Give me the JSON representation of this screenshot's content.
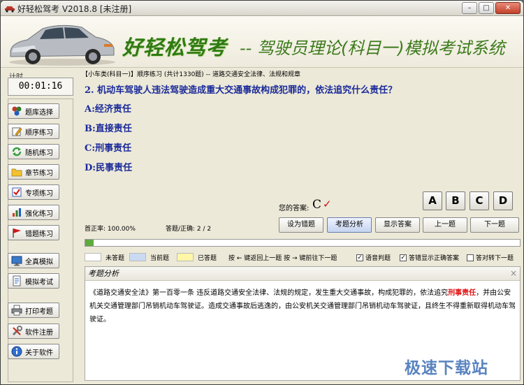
{
  "window": {
    "title": "好轻松驾考 V2018.8 [未注册]",
    "minimize": "–",
    "maximize": "□",
    "close": "✕"
  },
  "banner": {
    "title": "好轻松驾考",
    "subtitle": "-- 驾驶员理论(科目一)模拟考试系统"
  },
  "timer": {
    "label": "计时",
    "value": "00:01:16"
  },
  "sidebar": {
    "items": [
      {
        "label": "题库选择",
        "icon": "database-icon"
      },
      {
        "label": "顺序练习",
        "icon": "pencil-icon"
      },
      {
        "label": "随机练习",
        "icon": "shuffle-icon"
      },
      {
        "label": "章节练习",
        "icon": "folder-icon"
      },
      {
        "label": "专项练习",
        "icon": "checklist-icon"
      },
      {
        "label": "强化练习",
        "icon": "chart-icon"
      },
      {
        "label": "错题练习",
        "icon": "flag-icon"
      },
      {
        "label": "全真模拟",
        "icon": "monitor-icon"
      },
      {
        "label": "模拟考试",
        "icon": "document-icon"
      },
      {
        "label": "打印考题",
        "icon": "printer-icon"
      },
      {
        "label": "软件注册",
        "icon": "tools-icon"
      },
      {
        "label": "关于软件",
        "icon": "info-icon"
      }
    ]
  },
  "question": {
    "breadcrumb": "【小车类(科目一)】顺序练习 (共计1330题) -- 道路交通安全法律、法规和规章",
    "text": "2. 机动车驾驶人违法驾驶造成重大交通事故构成犯罪的，依法追究什么责任？",
    "options": [
      "A:经济责任",
      "B:直接责任",
      "C:刑事责任",
      "D:民事责任"
    ]
  },
  "choices": [
    "A",
    "B",
    "C",
    "D"
  ],
  "answer": {
    "label": "您的答案:",
    "value": "C",
    "mark": "✓"
  },
  "stats": {
    "accuracy": "首正率: 100.00%",
    "answered": "答题/正确: 2 / 2"
  },
  "actions": {
    "mark_wrong": "设为错题",
    "analysis": "考题分析",
    "show_answer": "显示答案",
    "prev": "上一题",
    "next": "下一题"
  },
  "progress": {
    "value": 0.0015
  },
  "legend": {
    "unanswered": "未答题",
    "current": "当前题",
    "answered": "已答题",
    "key_hint": "按 ← 键返回上一题   按 → 键前往下一题",
    "colors": {
      "unanswered": "#ffffff",
      "current": "#c9daf2",
      "answered": "#fff6a8"
    }
  },
  "options_toggles": [
    {
      "label": "语音判题",
      "checked": true
    },
    {
      "label": "答错显示正确答案",
      "checked": true
    },
    {
      "label": "答对转下一题",
      "checked": false
    }
  ],
  "analysis": {
    "title": "考题分析",
    "close": "×",
    "text_before": "《道路交通安全法》第一百零一条   违反道路交通安全法律、法规的规定，发生重大交通事故，构成犯罪的，依法追究",
    "highlight": "刑事责任",
    "text_after": "，并由公安机关交通管理部门吊销机动车驾驶证。造成交通事故后逃逸的，由公安机关交通管理部门吊销机动车驾驶证，且终生不得重新取得机动车驾驶证。"
  },
  "watermark": "极速下载站"
}
